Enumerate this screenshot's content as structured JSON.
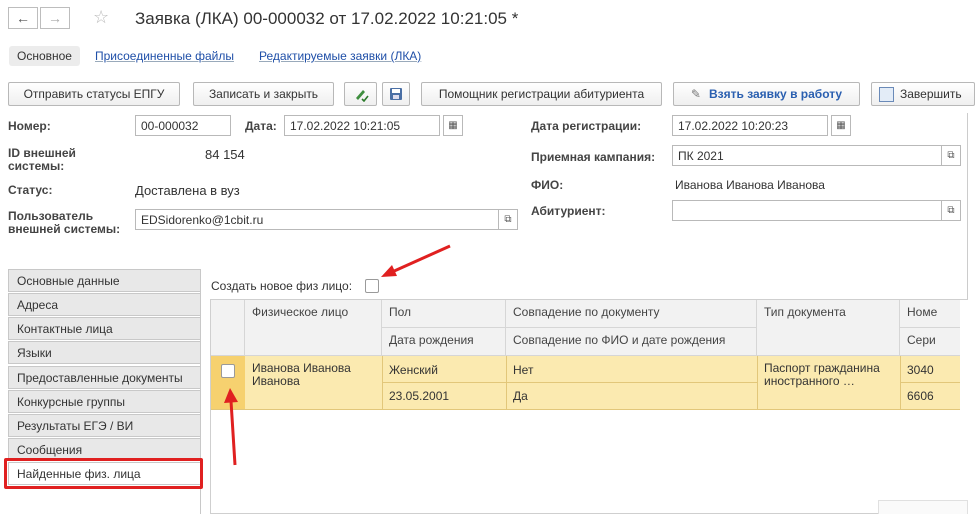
{
  "window": {
    "title": "Заявка (ЛКА) 00-000032 от 17.02.2022 10:21:05 *",
    "back_icon": "←",
    "forward_icon": "→",
    "star_icon": "☆"
  },
  "form_tabs": [
    {
      "label": "Основное"
    },
    {
      "label": "Присоединенные файлы"
    },
    {
      "label": "Редактируемые заявки (ЛКА)"
    }
  ],
  "toolbar": {
    "send_status": "Отправить статусы ЕПГУ",
    "save_close": "Записать и закрыть",
    "registration_helper": "Помощник регистрации абитуриента",
    "take_to_work": "Взять заявку в работу",
    "finish": "Завершить"
  },
  "fields": {
    "number_label": "Номер:",
    "number_value": "00-000032",
    "date_label": "Дата:",
    "date_value": "17.02.2022 10:21:05",
    "reg_date_label": "Дата регистрации:",
    "reg_date_value": "17.02.2022 10:20:23",
    "external_id_label": "ID внешней системы:",
    "external_id_value": "84 154",
    "campaign_label": "Приемная кампания:",
    "campaign_value": "ПК 2021",
    "status_label": "Статус:",
    "status_value": "Доставлена в вуз",
    "fio_label": "ФИО:",
    "fio_value": "Иванова Иванова Иванова",
    "user_label": "Пользователь внешней системы:",
    "user_value": "EDSidorenko@1cbit.ru",
    "applicant_label": "Абитуриент:",
    "applicant_value": ""
  },
  "page_tabs": [
    {
      "label": "Основные данные"
    },
    {
      "label": "Адреса"
    },
    {
      "label": "Контактные лица"
    },
    {
      "label": "Языки"
    },
    {
      "label": "Предоставленные документы"
    },
    {
      "label": "Конкурсные группы"
    },
    {
      "label": "Результаты ЕГЭ / ВИ"
    },
    {
      "label": "Сообщения"
    },
    {
      "label": "Найденные физ. лица"
    }
  ],
  "found_persons": {
    "create_new_label": "Создать новое физ лицо:",
    "columns": {
      "person": "Физическое лицо",
      "gender": "Пол",
      "birth_date": "Дата рождения",
      "doc_match": "Совпадение по документу",
      "fio_match": "Совпадение по ФИО и дате рождения",
      "doc_type": "Тип документа",
      "number": "Номе",
      "series": "Сери"
    },
    "rows": [
      {
        "person": "Иванова Иванова Иванова",
        "gender": "Женский",
        "birth_date": "23.05.2001",
        "doc_match": "Нет",
        "fio_match": "Да",
        "doc_type": "Паспорт гражданина иностранного …",
        "number": "3040",
        "series": "6606"
      }
    ]
  },
  "colors": {
    "highlight_row": "#fbeab0",
    "highlight_row_selected": "#f6d16f",
    "annotation_red": "#e02020",
    "link_blue": "#1f4fa8"
  }
}
